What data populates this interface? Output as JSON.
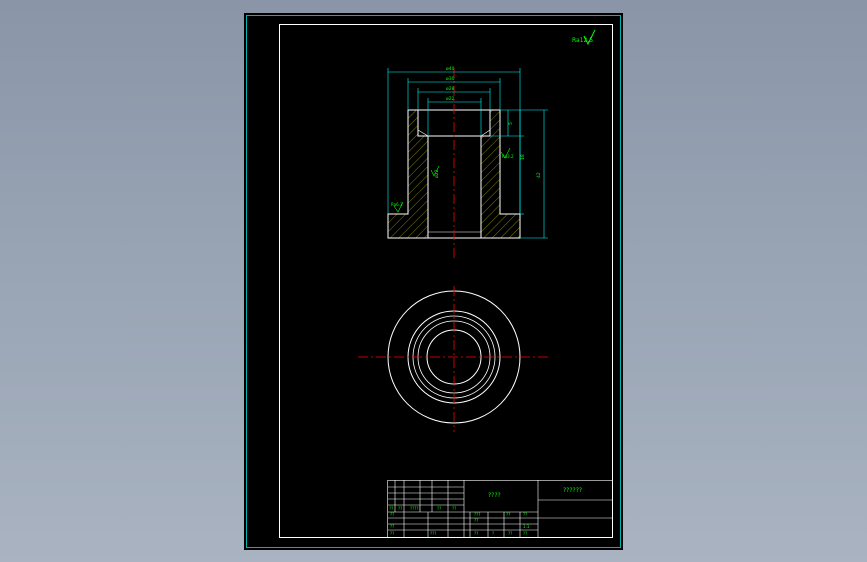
{
  "colors": {
    "background_gradient": [
      "#8a96a8",
      "#a9b3c1"
    ],
    "sheet": "#000000",
    "outer_frame": "#00b3b3",
    "inner_frame": "#ffffff",
    "dimension": "#00ffff",
    "text": "#00ff00",
    "center_line": "#ff0000",
    "outline": "#ffffff",
    "hatch": "#d8d800"
  },
  "roughness_symbol": {
    "label": "Ra12.5",
    "icon": "surface-roughness-icon"
  },
  "dimensions": {
    "top_1": "ø40",
    "top_2": "ø30",
    "top_3": "ø28",
    "top_4": "ø22",
    "right_1": "5",
    "right_2": "18",
    "right_3": "42",
    "bore_label": "ø22",
    "counterbore_label": "Ra3.2",
    "outer_wall_label": "Ra6.3"
  },
  "title_block": {
    "drawing_name": "????",
    "company": "??????",
    "row_labels": [
      "??",
      "??",
      "?????",
      "??",
      "??"
    ],
    "row2_labels": [
      "???",
      "??",
      "??"
    ],
    "cells_bottom": [
      "??",
      "???",
      "??",
      "?",
      "??"
    ],
    "scale_label": "1:1",
    "sheet_label": "??",
    "mid_labels": [
      "??",
      "??",
      "??"
    ]
  }
}
